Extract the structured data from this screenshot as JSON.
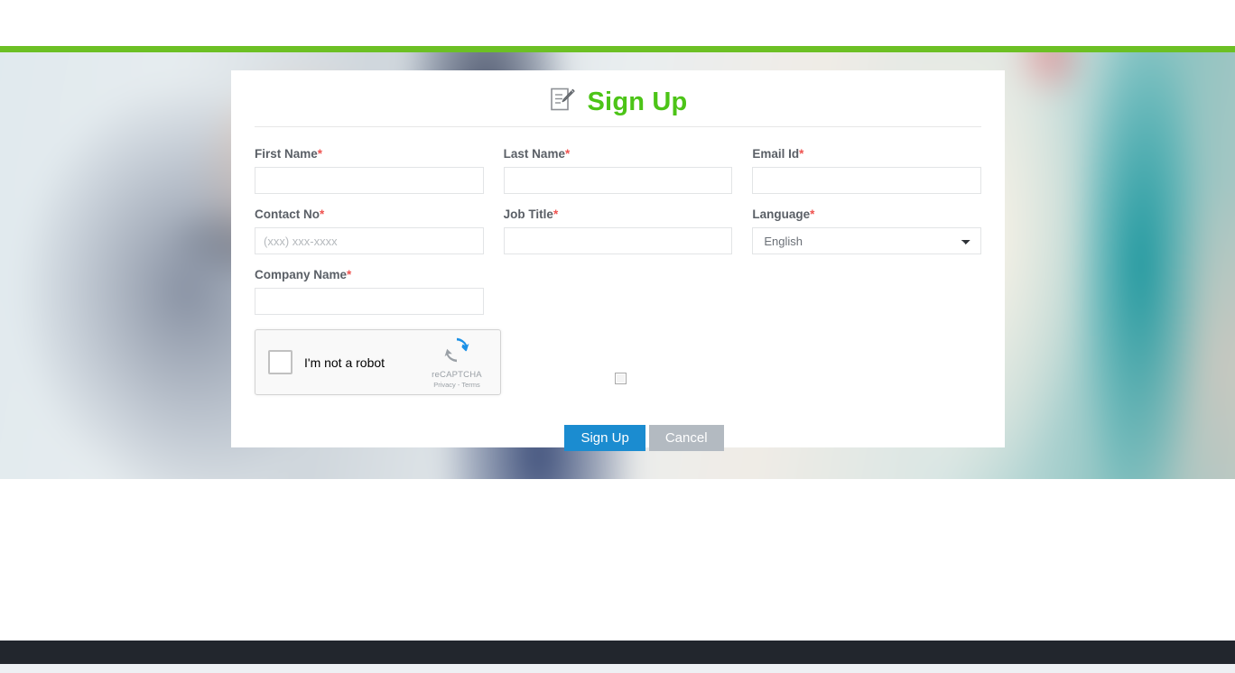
{
  "theme": {
    "accent_green": "#6cc024",
    "title_green": "#4cc417",
    "primary_blue": "#1b8cd0",
    "secondary_gray": "#b3bac1",
    "required_red": "#ef5350",
    "footer_dark": "#22262d"
  },
  "card": {
    "title": "Sign Up",
    "title_icon": "signup-document-pencil-icon"
  },
  "form": {
    "required_marker": "*",
    "fields": [
      {
        "id": "first-name",
        "label": "First Name",
        "required": true,
        "value": "",
        "placeholder": ""
      },
      {
        "id": "last-name",
        "label": "Last Name",
        "required": true,
        "value": "",
        "placeholder": ""
      },
      {
        "id": "email-id",
        "label": "Email Id",
        "required": true,
        "value": "",
        "placeholder": ""
      },
      {
        "id": "contact-no",
        "label": "Contact No",
        "required": true,
        "value": "",
        "placeholder": "(xxx) xxx-xxxx"
      },
      {
        "id": "job-title",
        "label": "Job Title",
        "required": true,
        "value": "",
        "placeholder": ""
      },
      {
        "id": "language",
        "label": "Language",
        "required": true,
        "value": "English",
        "placeholder": ""
      },
      {
        "id": "company-name",
        "label": "Company Name",
        "required": true,
        "value": "",
        "placeholder": ""
      }
    ],
    "language_options": [
      "English"
    ]
  },
  "captcha": {
    "checkbox_label": "I'm not a robot",
    "brand_name": "reCAPTCHA",
    "legal_text": "Privacy - Terms",
    "logo_icon": "recaptcha-refresh-arrows-icon",
    "checked": false
  },
  "consent": {
    "checked": false
  },
  "buttons": {
    "submit_label": "Sign Up",
    "cancel_label": "Cancel"
  }
}
